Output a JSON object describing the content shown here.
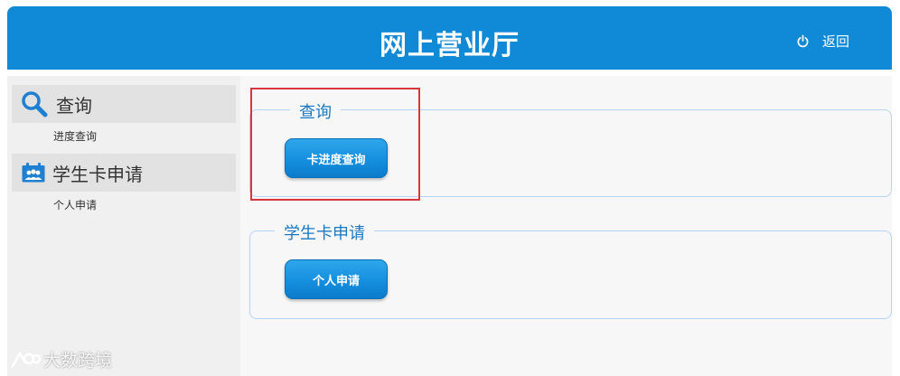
{
  "header": {
    "title": "网上营业厅",
    "back_label": "返回",
    "power_icon": "power-icon"
  },
  "sidebar": {
    "sections": [
      {
        "title": "查询",
        "icon": "search-icon",
        "items": [
          "进度查询"
        ]
      },
      {
        "title": "学生卡申请",
        "icon": "calendar-people-icon",
        "items": [
          "个人申请"
        ]
      }
    ]
  },
  "main": {
    "groups": [
      {
        "legend": "查询",
        "button": "卡进度查询",
        "highlighted": true
      },
      {
        "legend": "学生卡申请",
        "button": "个人申请",
        "highlighted": false
      }
    ]
  },
  "watermark": {
    "text": "大数跨境"
  },
  "colors": {
    "header_bg": "#1089d6",
    "accent_text": "#1a78c2",
    "button_bg": "#158ede",
    "highlight_border": "#d9363b",
    "group_border": "#b3d4f5"
  }
}
